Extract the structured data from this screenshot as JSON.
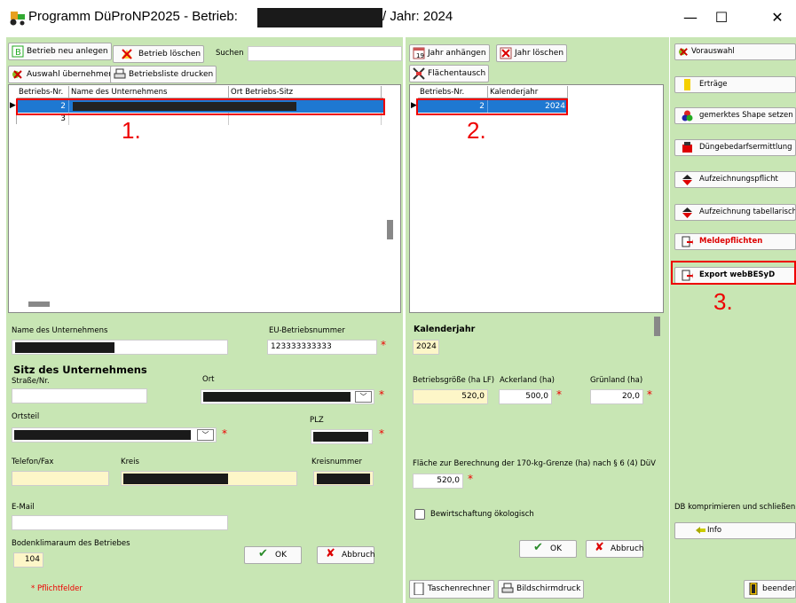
{
  "window": {
    "title_part1": "Programm DüProNP2025 - Betrieb:",
    "title_part2": "/ Jahr: 2024",
    "min": "—",
    "max": "☐",
    "close": "✕"
  },
  "left": {
    "btn_new": "Betrieb neu anlegen",
    "btn_delete": "Betrieb löschen",
    "search_label": "Suchen",
    "btn_apply": "Auswahl übernehmen",
    "btn_print": "Betriebsliste drucken",
    "columns": [
      "Betriebs-Nr.",
      "Name des Unternehmens",
      "Ort Betriebs-Sitz"
    ],
    "rows": [
      {
        "nr": "2"
      },
      {
        "nr": "3"
      }
    ],
    "form": {
      "name_label": "Name des Unternehmens",
      "eu_label": "EU-Betriebsnummer",
      "eu_value": "123333333333",
      "sitz_heading": "Sitz des Unternehmens",
      "street_label": "Straße/Nr.",
      "ort_label": "Ort",
      "ortsteil_label": "Ortsteil",
      "plz_label": "PLZ",
      "phone_label": "Telefon/Fax",
      "kreis_label": "Kreis",
      "kreisnr_label": "Kreisnummer",
      "email_label": "E-Mail",
      "boden_label": "Bodenklimaraum des Betriebes",
      "boden_value": "104",
      "ok": "OK",
      "cancel": "Abbruch"
    },
    "required_note": "* Pflichtfelder"
  },
  "middle": {
    "btn_add_year": "Jahr anhängen",
    "btn_del_year": "Jahr löschen",
    "btn_swap": "Flächentausch",
    "columns": [
      "Betriebs-Nr.",
      "Kalenderjahr"
    ],
    "rows": [
      {
        "nr": "2",
        "year": "2024"
      }
    ],
    "form": {
      "year_heading": "Kalenderjahr",
      "year_value": "2024",
      "size_label": "Betriebsgröße (ha LF)",
      "size_value": "520,0",
      "acker_label": "Ackerland (ha)",
      "acker_value": "500,0",
      "gruen_label": "Grünland (ha)",
      "gruen_value": "20,0",
      "area170_label": "Fläche zur Berechnung der 170-kg-Grenze (ha) nach § 6 (4) DüV",
      "area170_value": "520,0",
      "organic_label": "Bewirtschaftung ökologisch",
      "ok": "OK",
      "cancel": "Abbruch"
    },
    "btn_calc": "Taschenrechner",
    "btn_screen": "Bildschirmdruck"
  },
  "right": {
    "items": [
      "Vorauswahl",
      "Erträge",
      "gemerktes Shape setzen",
      "Düngebedarfsermittlung",
      "Aufzeichnungspflicht",
      "Aufzeichnung tabellarisch",
      "Meldepflichten",
      "Export webBESyD"
    ],
    "btn_compress": "DB komprimieren und schließen",
    "btn_info": "Info",
    "btn_quit": "beenden"
  },
  "annotations": [
    "1.",
    "2.",
    "3."
  ],
  "colors": {
    "panel": "#c8e6b4",
    "selection": "#1e78d2",
    "highlight": "#e00000",
    "required": "#e00000"
  }
}
